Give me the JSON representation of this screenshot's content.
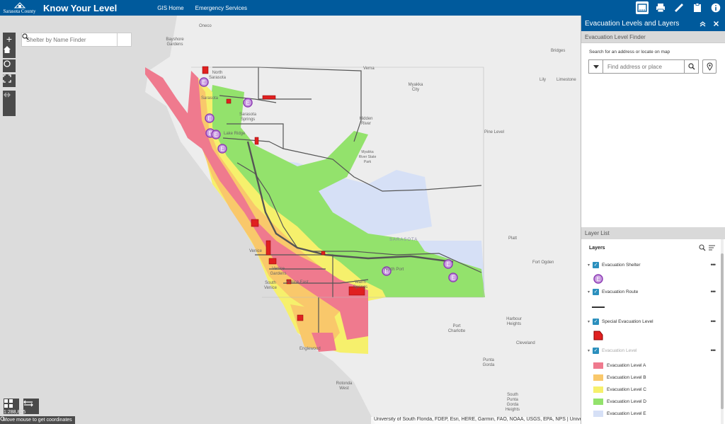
{
  "header": {
    "logo_text": "Sarasota County",
    "title": "Know Your Level",
    "links": [
      "GIS Home",
      "Emergency Services"
    ],
    "icons": [
      "layer-list-icon",
      "print-icon",
      "measure-icon",
      "clipboard-icon",
      "info-icon"
    ]
  },
  "map": {
    "search_placeholder": "Shelter by Name Finder",
    "zoom_in": "+",
    "zoom_out": "−",
    "scale_text": "1:288,895",
    "coords_text": "Move mouse to get coordinates",
    "attribution": "University of South Florida, FDEP, Esri, HERE, Garmin, FAO, NOAA, USGS, EPA, NPS | University of South Florida, FDEP, Esri, HERE, Garmin",
    "labels": {
      "oneco": "Oneco",
      "bayshore": "Bayshore Gardens",
      "north_sarasota": "North Sarasota",
      "sarasota": "Sarasota",
      "sarasota_springs": "Sarasota Springs",
      "lake_ridge": "Lake Ridge",
      "verna": "Verna",
      "myakka_city": "Myakka City",
      "hidden_river": "Hidden River",
      "myakka_park": "Myakka River State Park",
      "bridges": "Bridges",
      "lily": "Lily",
      "limestone": "Limestone",
      "pine_level": "Pine Level",
      "venice": "Venice",
      "venice_gardens": "Venice Gardens",
      "venice_east": "Venice East",
      "south_venice": "South Venice",
      "north_port": "North Port",
      "warm_springs": "Warm Springs",
      "englewood": "Englewood",
      "rotonda": "Rotonda West",
      "port_charlotte": "Port Charlotte",
      "harbour": "Harbour Heights",
      "cleveland": "Cleveland",
      "punta_gorda": "Punta Gorda",
      "south_punta_gorda": "South Punta Gorda Heights",
      "fort_ogden": "Fort Ogden",
      "platt": "Platt",
      "sarasota_county": "SARASOTA"
    }
  },
  "panel": {
    "title": "Evacuation Levels and Layers",
    "finder_title": "Evacuation Level Finder",
    "finder_hint": "Search for an address or locate on map",
    "finder_placeholder": "Find address or place",
    "layerlist_title": "Layer List",
    "layers_heading": "Layers",
    "layers": [
      {
        "name": "Evacuation Shelter",
        "enabled": true
      },
      {
        "name": "Evacuation Route",
        "enabled": true
      },
      {
        "name": "Special Evacuation Level",
        "enabled": true
      },
      {
        "name": "Evacuation Level",
        "enabled": false
      }
    ],
    "legend": [
      {
        "label": "Evacuation Level A",
        "color": "#ef7a8e"
      },
      {
        "label": "Evacuation Level B",
        "color": "#f9c86b"
      },
      {
        "label": "Evacuation Level C",
        "color": "#f6f06c"
      },
      {
        "label": "Evacuation Level D",
        "color": "#93e26c"
      },
      {
        "label": "Evacuation Level E",
        "color": "#d6e0f6"
      }
    ]
  },
  "colors": {
    "brand": "#005a9c",
    "shelter": "#8e3fb5",
    "special": "#e02020"
  }
}
